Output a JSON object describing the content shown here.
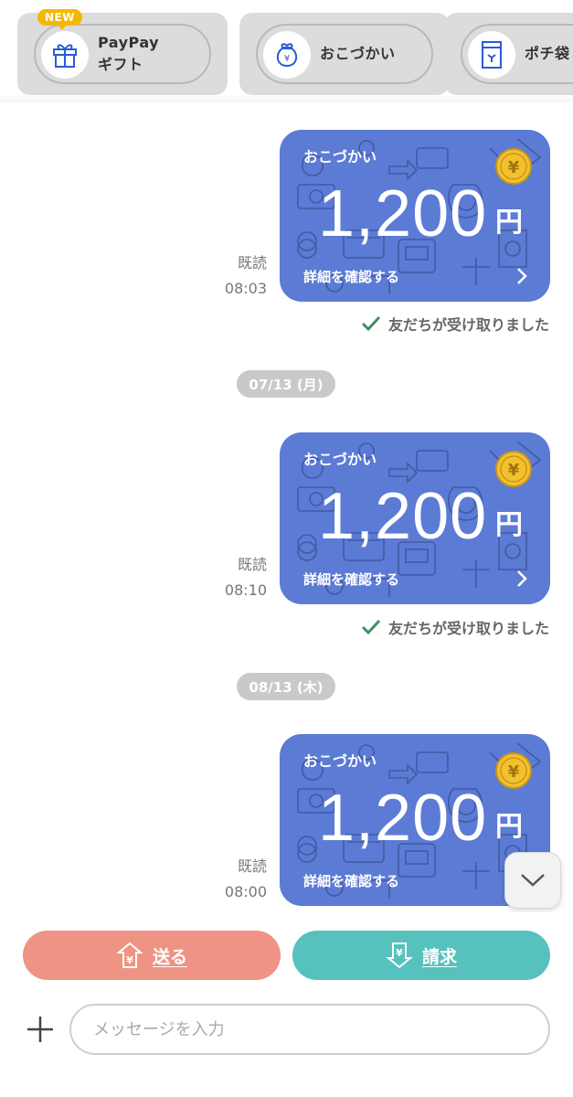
{
  "shortcuts": [
    {
      "label_line1": "PayPay",
      "label_line2": "ギフト",
      "badge": "NEW",
      "icon": "gift-icon"
    },
    {
      "label": "おこづかい",
      "icon": "money-pouch-icon"
    },
    {
      "label": "ポチ袋",
      "icon": "envelope-icon"
    }
  ],
  "messages": [
    {
      "read": "既読",
      "time": "08:03",
      "title": "おこづかい",
      "amount": "1,200",
      "unit": "円",
      "detail": "詳細を確認する",
      "received": "友だちが受け取りました"
    },
    {
      "read": "既読",
      "time": "08:10",
      "title": "おこづかい",
      "amount": "1,200",
      "unit": "円",
      "detail": "詳細を確認する",
      "received": "友だちが受け取りました"
    },
    {
      "read": "既読",
      "time": "08:00",
      "title": "おこづかい",
      "amount": "1,200",
      "unit": "円",
      "detail": "詳細を確認する"
    }
  ],
  "dates": [
    "07/13 (月)",
    "08/13 (木)"
  ],
  "coin_symbol": "¥",
  "actions": {
    "send_label": "送る",
    "request_label": "請求"
  },
  "input": {
    "placeholder": "メッセージを入力"
  },
  "colors": {
    "card": "#5b7bd5",
    "send": "#ef9484",
    "request": "#57c1be",
    "badge": "#f5b800",
    "check": "#3d8f5f"
  }
}
